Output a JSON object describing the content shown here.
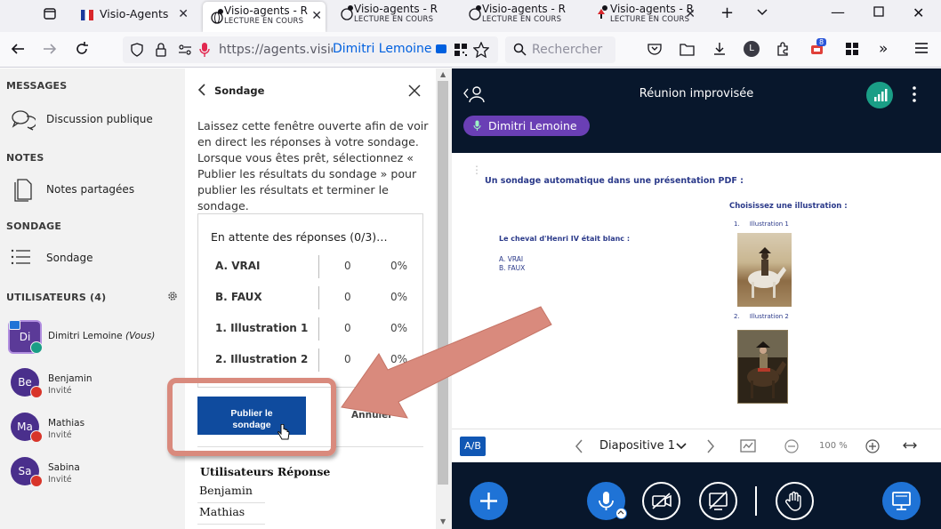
{
  "browser": {
    "tabs": [
      {
        "title": "Visio-Agents",
        "subtitle": "",
        "active": false
      },
      {
        "title": "Visio-agents - R",
        "subtitle": "LECTURE EN COURS",
        "active": true
      },
      {
        "title": "Visio-agents - R",
        "subtitle": "LECTURE EN COURS",
        "active": false
      },
      {
        "title": "Visio-agents - R",
        "subtitle": "LECTURE EN COURS",
        "active": false
      },
      {
        "title": "Visio-agents - R",
        "subtitle": "LECTURE EN COURS",
        "active": false
      }
    ],
    "url": "https://agents.visio.",
    "autofill_name": "Dimitri Lemoine",
    "search_placeholder": "Rechercher",
    "extension_badge": "8",
    "account_letter": "L"
  },
  "sidebar": {
    "messages_header": "MESSAGES",
    "public_chat": "Discussion publique",
    "notes_header": "NOTES",
    "shared_notes": "Notes partagées",
    "poll_header": "SONDAGE",
    "poll_item": "Sondage",
    "users_header": "UTILISATEURS (4)",
    "users": [
      {
        "initials": "Di",
        "name": "Dimitri Lemoine",
        "suffix": "(Vous)",
        "role": ""
      },
      {
        "initials": "Be",
        "name": "Benjamin",
        "suffix": "",
        "role": "Invité"
      },
      {
        "initials": "Ma",
        "name": "Mathias",
        "suffix": "",
        "role": "Invité"
      },
      {
        "initials": "Sa",
        "name": "Sabina",
        "suffix": "",
        "role": "Invité"
      }
    ]
  },
  "poll": {
    "title": "Sondage",
    "description": "Laissez cette fenêtre ouverte afin de voir en direct les réponses à votre sondage. Lorsque vous êtes prêt, sélectionnez « Publier les résultats du sondage » pour publier les résultats et terminer le sondage.",
    "waiting": "En attente des réponses (0/3)…",
    "options": [
      {
        "label": "A. VRAI",
        "count": "0",
        "percent": "0%"
      },
      {
        "label": "B. FAUX",
        "count": "0",
        "percent": "0%"
      },
      {
        "label": "1. Illustration 1",
        "count": "0",
        "percent": "0%"
      },
      {
        "label": "2. Illustration 2",
        "count": "0",
        "percent": "0%"
      }
    ],
    "publish_line1": "Publier le",
    "publish_line2": "sondage",
    "cancel": "Annuler",
    "responses_header": "Utilisateurs Réponse",
    "respondents": [
      "Benjamin",
      "Mathias"
    ]
  },
  "meeting": {
    "title": "Réunion improvisée",
    "speaker": "Dimitri Lemoine",
    "slide": {
      "heading": "Un sondage automatique dans une présentation PDF :",
      "choose": "Choisissez une illustration :",
      "question": "Le cheval d'Henri IV était blanc :",
      "answer_a": "A. VRAI",
      "answer_b": "B. FAUX",
      "illus1_num": "1.",
      "illus1": "Illustration 1",
      "illus2_num": "2.",
      "illus2": "Illustration 2"
    },
    "ab_label": "A/B",
    "slide_selector": "Diapositive 1",
    "zoom": "100 %"
  },
  "colors": {
    "publish_button": "#0f4b9e",
    "meeting_bg": "#08172c",
    "speaker_pill": "#6a3fb5",
    "action_blue": "#1f73d6",
    "annotation": "#d98a7d",
    "signal_green": "#1a9e86"
  }
}
